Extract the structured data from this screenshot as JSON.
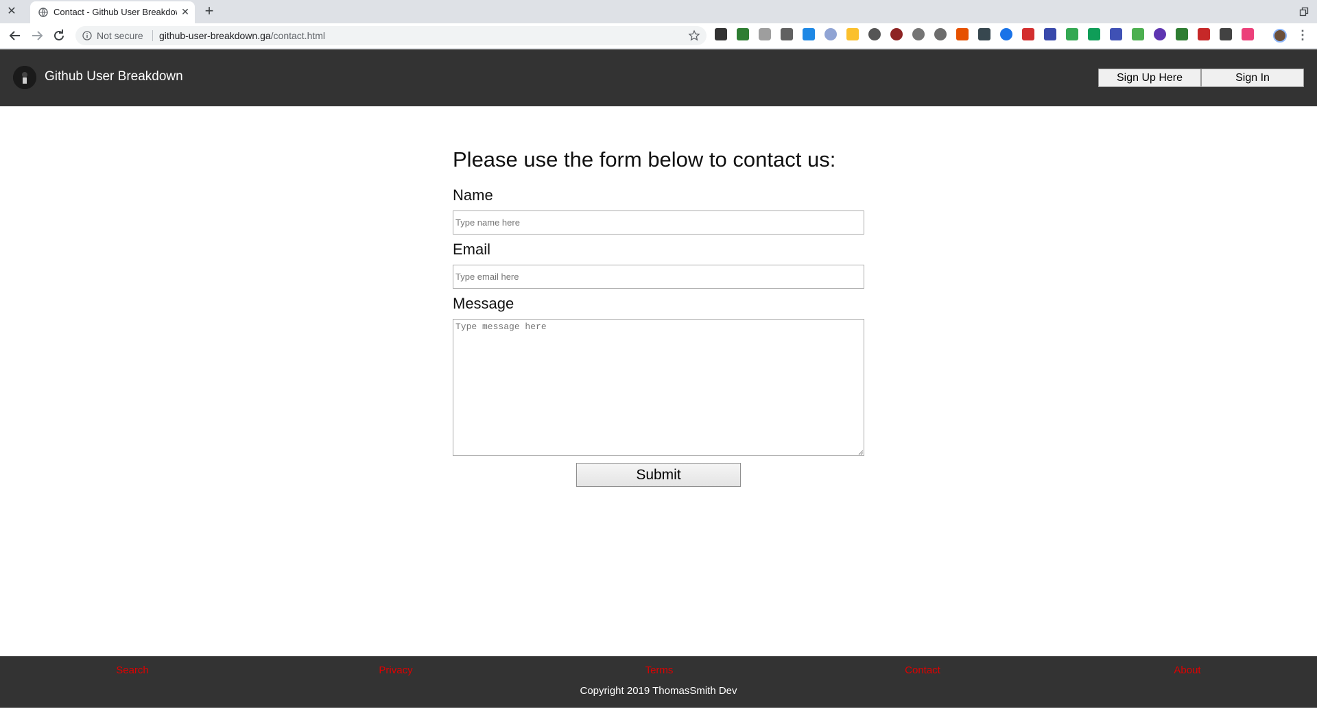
{
  "browser": {
    "tab_title": "Contact - Github User Breakdown",
    "security_label": "Not secure",
    "url_host": "github-user-breakdown.ga",
    "url_path": "/contact.html"
  },
  "header": {
    "brand": "Github User Breakdown",
    "signup_label": "Sign Up Here",
    "signin_label": "Sign In",
    "background": "#333333"
  },
  "form": {
    "title": "Please use the form below to contact us:",
    "name_label": "Name",
    "name_placeholder": "Type name here",
    "email_label": "Email",
    "email_placeholder": "Type email here",
    "message_label": "Message",
    "message_placeholder": "Type message here",
    "submit_label": "Submit"
  },
  "footer": {
    "links": [
      "Search",
      "Privacy",
      "Terms",
      "Contact",
      "About"
    ],
    "link_color": "#e00000",
    "copyright": "Copyright 2019 ThomasSmith Dev"
  }
}
